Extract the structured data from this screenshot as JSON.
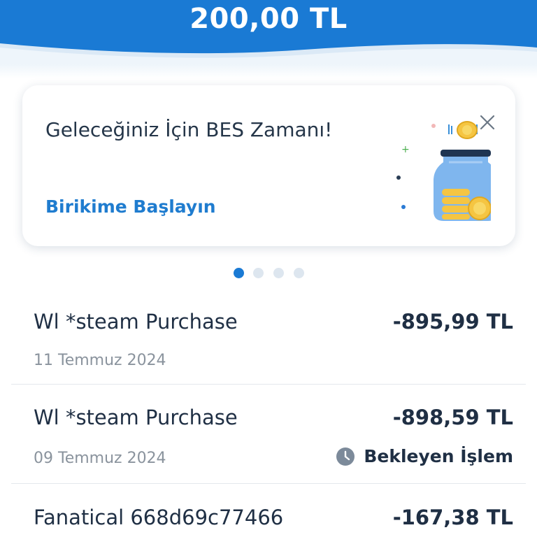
{
  "header": {
    "balance": "200,00 TL",
    "color": "#1a7ad4"
  },
  "promo": {
    "title": "Geleceğiniz İçin BES Zamanı!",
    "cta": "Birikime Başlayın",
    "close_icon": "close-icon",
    "illustration": "coin-jar-illustration"
  },
  "carousel": {
    "count": 4,
    "active_index": 0
  },
  "transactions": [
    {
      "name": "Wl *steam Purchase",
      "date": "11 Temmuz 2024",
      "amount": "-895,99 TL",
      "status": ""
    },
    {
      "name": "Wl *steam Purchase",
      "date": "09 Temmuz 2024",
      "amount": "-898,59 TL",
      "status": "Bekleyen İşlem",
      "status_icon": "clock-icon"
    },
    {
      "name": "Fanatical 668d69c77466",
      "date": "",
      "amount": "-167,38 TL",
      "status": ""
    }
  ]
}
